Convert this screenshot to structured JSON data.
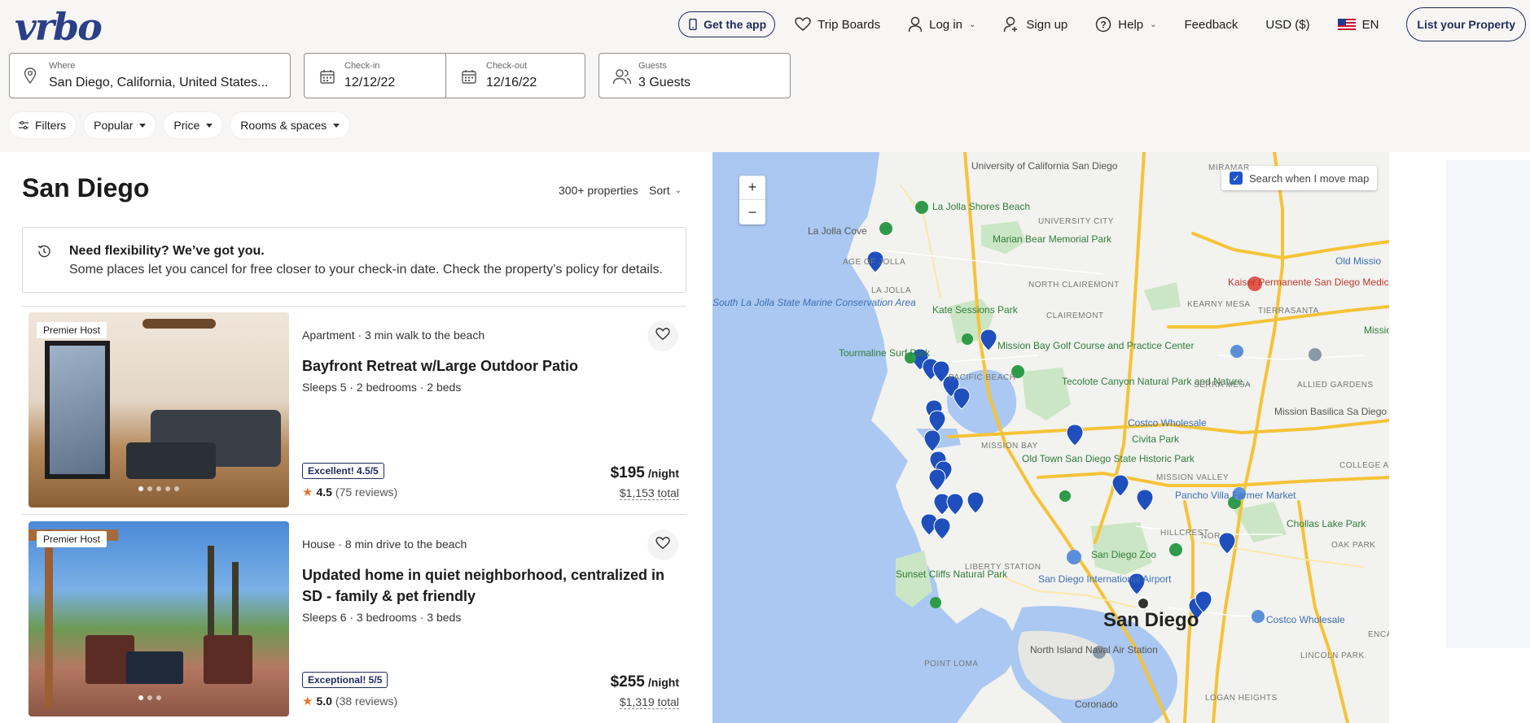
{
  "app": {
    "logo": "vrbo"
  },
  "nav": {
    "get_app": "Get the app",
    "trip_boards": "Trip Boards",
    "log_in": "Log in",
    "sign_up": "Sign up",
    "help": "Help",
    "feedback": "Feedback",
    "currency": "USD ($)",
    "language": "EN",
    "list_property": "List your Property"
  },
  "search": {
    "where_label": "Where",
    "where_value": "San Diego, California, United States...",
    "checkin_label": "Check-in",
    "checkin_value": "12/12/22",
    "checkout_label": "Check-out",
    "checkout_value": "12/16/22",
    "guests_label": "Guests",
    "guests_value": "3 Guests"
  },
  "filters": [
    "Filters",
    "Popular",
    "Price",
    "Rooms & spaces"
  ],
  "results": {
    "title": "San Diego",
    "count": "300+ properties",
    "sort": "Sort"
  },
  "flexibility": {
    "title": "Need flexibility? We’ve got you.",
    "body": "Some places let you cancel for free closer to your check-in date. Check the property’s policy for details."
  },
  "listings": [
    {
      "badge": "Premier Host",
      "type": "Apartment · 3 min walk to the beach",
      "name": "Bayfront Retreat w/Large Outdoor Patio",
      "specs": "Sleeps 5 · 2 bedrooms · 2 beds",
      "rating_label": "Excellent! 4.5/5",
      "rating": "4.5",
      "reviews": "(75 reviews)",
      "price": "$195",
      "price_unit": "/night",
      "total": "$1,153 total"
    },
    {
      "badge": "Premier Host",
      "type": "House · 8 min drive to the beach",
      "name": "Updated home in quiet neighborhood, centralized in SD - family & pet friendly",
      "specs": "Sleeps 6 · 3 bedrooms · 3 beds",
      "rating_label": "Exceptional! 5/5",
      "rating": "5.0",
      "reviews": "(38 reviews)",
      "price": "$255",
      "price_unit": "/night",
      "total": "$1,319 total"
    }
  ],
  "map": {
    "search_when_move": "Search when I move map",
    "zoom_in": "+",
    "zoom_out": "−",
    "labels": {
      "university": "University of California San Diego",
      "la_jolla_shores": "La Jolla Shores Beach",
      "la_jolla_cove": "La Jolla Cove",
      "marian_bear": "Marian Bear Memorial Park",
      "kaiser": "Kaiser Permanente San Diego Medical Ctr",
      "south_la_jolla": "South La Jolla State Marine Conservation Area",
      "kate_sessions": "Kate Sessions Park",
      "mission_bay_golf": "Mission Bay Golf Course and Practice Center",
      "tourmaline": "Tourmaline Surf Park",
      "tecolote": "Tecolote Canyon Natural Park and Nature...",
      "costco1": "Costco Wholesale",
      "civita": "Civita Park",
      "old_town": "Old Town San Diego State Historic Park",
      "pancho": "Pancho Villa Farmer Market",
      "chollas": "Chollas Lake Park",
      "zoo": "San Diego Zoo",
      "airport": "San Diego International Airport",
      "sunset_cliffs": "Sunset Cliffs Natural Park",
      "north_island": "North Island Naval Air Station",
      "san_diego": "San Diego",
      "costco2": "Costco Wholesale",
      "coronado": "Coronado",
      "old_mission": "Old Missio",
      "mission_regi": "Missio Regi",
      "basilica": "Mission Basilica Sa Diego de Alcala",
      "clairemont": "NORTH CLAIREMONT",
      "clairemont2": "CLAIREMONT",
      "kearny": "KEARNY MESA",
      "tierrasanta": "TIERRASANTA",
      "serra": "SERRA MESA",
      "allied": "ALLIED GARDENS",
      "university_city": "UNIVERSITY CITY",
      "la_jolla": "LA JOLLA",
      "mission_bay": "MISSION BAY",
      "mission_valley": "MISSION VALLEY",
      "college": "COLLEGE AR",
      "hillcrest": "HILLCREST",
      "oak_park": "OAK PARK",
      "liberty": "LIBERTY STATION",
      "point_loma": "POINT LOMA",
      "lincoln": "LINCOLN PARK",
      "logan": "LOGAN HEIGHTS",
      "miramar": "MIRAMAR",
      "pacific_beach": "PACIFIC BEACH",
      "village": "AGE OF JOLLA",
      "encan": "ENCA",
      "north_park": "NOR"
    }
  },
  "colors": {
    "brand": "#2a3f87",
    "pin": "#1f4fbd",
    "water": "#aac8f1",
    "park": "#cbe6c5",
    "highway": "#f5c338"
  }
}
